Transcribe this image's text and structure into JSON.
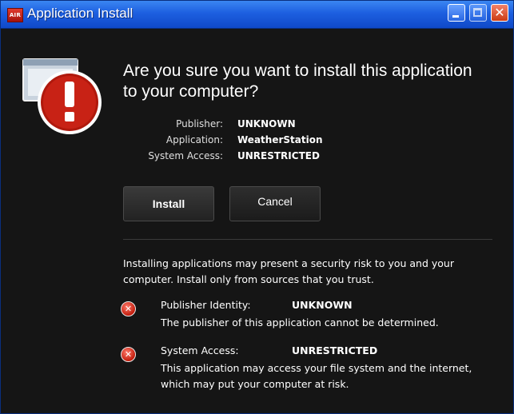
{
  "window": {
    "title": "Application Install",
    "app_icon_text": "AIR",
    "controls": {
      "minimize": "minimize-icon",
      "maximize": "maximize-icon",
      "close": "close-icon",
      "close_glyph": "✕"
    }
  },
  "dialog": {
    "question": "Are you sure you want to install this application to your computer?",
    "meta": [
      {
        "label": "Publisher:",
        "value": "UNKNOWN"
      },
      {
        "label": "Application:",
        "value": "WeatherStation"
      },
      {
        "label": "System Access:",
        "value": "UNRESTRICTED"
      }
    ],
    "install_label": "Install",
    "cancel_label": "Cancel",
    "warning": "Installing applications may present a security risk to you and your computer. Install only from sources that you trust.",
    "details": [
      {
        "label": "Publisher Identity:",
        "value": "UNKNOWN",
        "description": "The publisher of this application cannot be determined."
      },
      {
        "label": "System Access:",
        "value": "UNRESTRICTED",
        "description": "This application may access your file system and the internet, which may put your computer at risk."
      }
    ],
    "error_glyph": "✕"
  },
  "colors": {
    "titlebar": "#1d5fe0",
    "background": "#151515",
    "warning_red": "#c21d0d"
  }
}
